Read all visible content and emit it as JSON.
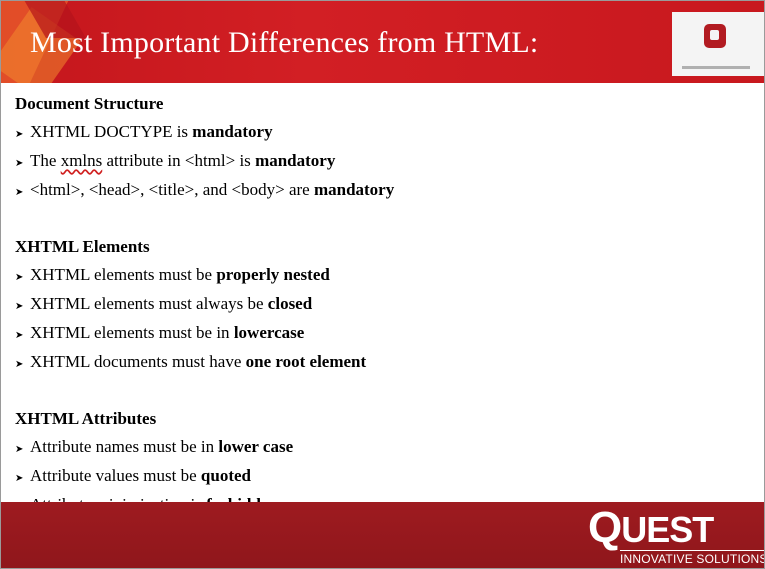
{
  "slide": {
    "title": "Most Important Differences from HTML:",
    "sections": [
      {
        "heading": "Document Structure",
        "items": [
          {
            "pre": "XHTML DOCTYPE is ",
            "bold": "mandatory"
          },
          {
            "pre": "The ",
            "word": "xmlns",
            "mid": " attribute in <html> is ",
            "bold": "mandatory"
          },
          {
            "pre": "<html>, <head>, <title>, and <body> are ",
            "bold": "mandatory"
          }
        ]
      },
      {
        "heading": "XHTML Elements",
        "items": [
          {
            "pre": "XHTML elements must be ",
            "bold": "properly nested"
          },
          {
            "pre": "XHTML elements must always be ",
            "bold": "closed"
          },
          {
            "pre": "XHTML elements must be in ",
            "bold": "lowercase"
          },
          {
            "pre": "XHTML documents must have ",
            "bold": "one root element"
          }
        ]
      },
      {
        "heading": "XHTML Attributes",
        "items": [
          {
            "pre": "Attribute names must be in ",
            "bold": "lower case"
          },
          {
            "pre": "Attribute values must be ",
            "bold": "quoted"
          },
          {
            "pre": "Attribute minimization is ",
            "bold": "forbidden"
          }
        ]
      }
    ],
    "bullet_glyph": "➤"
  },
  "footer": {
    "logo_text": "QUEST",
    "logo_first": "Q",
    "logo_rest": "UEST",
    "tagline": "INNOVATIVE SOLUTIONS"
  },
  "colors": {
    "header_red": "#c4161c",
    "footer_red": "#9e1b20"
  }
}
